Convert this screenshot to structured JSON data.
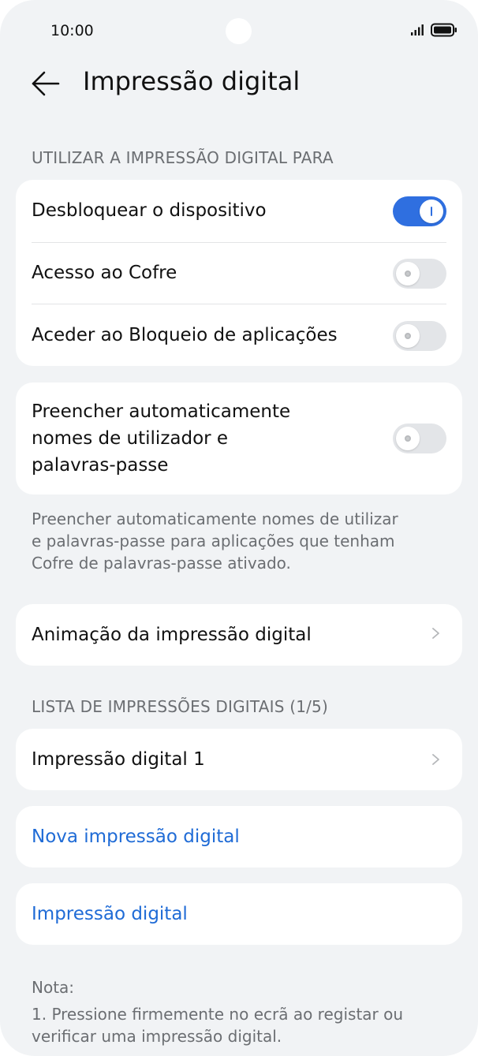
{
  "status_bar": {
    "time": "10:00"
  },
  "header": {
    "title": "Impressão digital",
    "back_icon": "arrow-left-icon"
  },
  "use_section": {
    "title": "UTILIZAR A IMPRESSÃO DIGITAL PARA",
    "items": [
      {
        "label": "Desbloquear o dispositivo",
        "enabled": true
      },
      {
        "label": "Acesso ao Cofre",
        "enabled": false
      },
      {
        "label": "Aceder ao Bloqueio de aplicações",
        "enabled": false
      }
    ]
  },
  "autofill": {
    "label_line1": "Preencher automaticamente",
    "label_line2": "nomes de utilizador e",
    "label_line3": "palavras-passe",
    "enabled": false,
    "description_line1": "Preencher automaticamente nomes de utilizar",
    "description_line2": "e palavras-passe para aplicações que tenham",
    "description_line3": "Cofre de palavras-passe ativado."
  },
  "animation": {
    "label": "Animação da impressão digital"
  },
  "list_section": {
    "title": "LISTA DE IMPRESSÕES DIGITAIS (1/5)",
    "items": [
      {
        "label": "Impressão digital 1"
      }
    ]
  },
  "actions": {
    "new_fingerprint": "Nova impressão digital",
    "identify_fingerprint": "Impressão digital"
  },
  "note": {
    "title": "Nota:",
    "line1": "1. Pressione firmemente no ecrã ao registar ou",
    "line2": "verificar uma impressão digital."
  },
  "colors": {
    "accent": "#2f6fe0",
    "link": "#1f6bd6",
    "background": "#f1f3f5",
    "card": "#ffffff"
  }
}
